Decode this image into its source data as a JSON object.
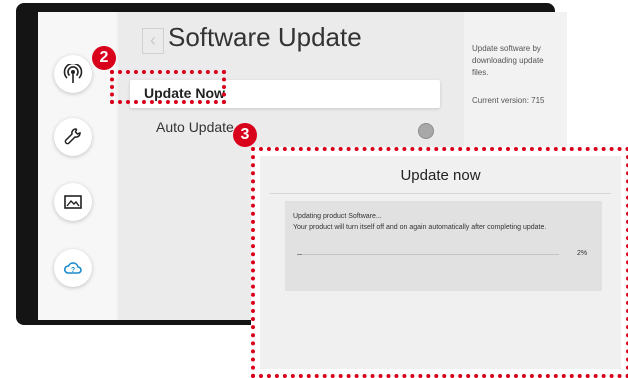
{
  "menu": {
    "back_glyph": "‹",
    "title": "Software Update",
    "items": [
      {
        "label": "Update Now",
        "selected": true
      },
      {
        "label": "Auto Update",
        "toggle_on": false
      }
    ]
  },
  "info": {
    "description": "Update software by downloading update files.",
    "current_version": "Current version: 715"
  },
  "sidebar": {
    "icons": [
      "broadcast-icon",
      "wrench-icon",
      "picture-icon",
      "support-cloud-icon"
    ]
  },
  "callouts": {
    "step_2": "2",
    "step_3": "3",
    "highlight_color": "#d9001b"
  },
  "popup": {
    "title": "Update now",
    "status_line": "Updating product Software...",
    "detail_line": "Your product will turn itself off and on again automatically after completing update.",
    "progress_value": 0.02,
    "progress_label": "2%"
  }
}
